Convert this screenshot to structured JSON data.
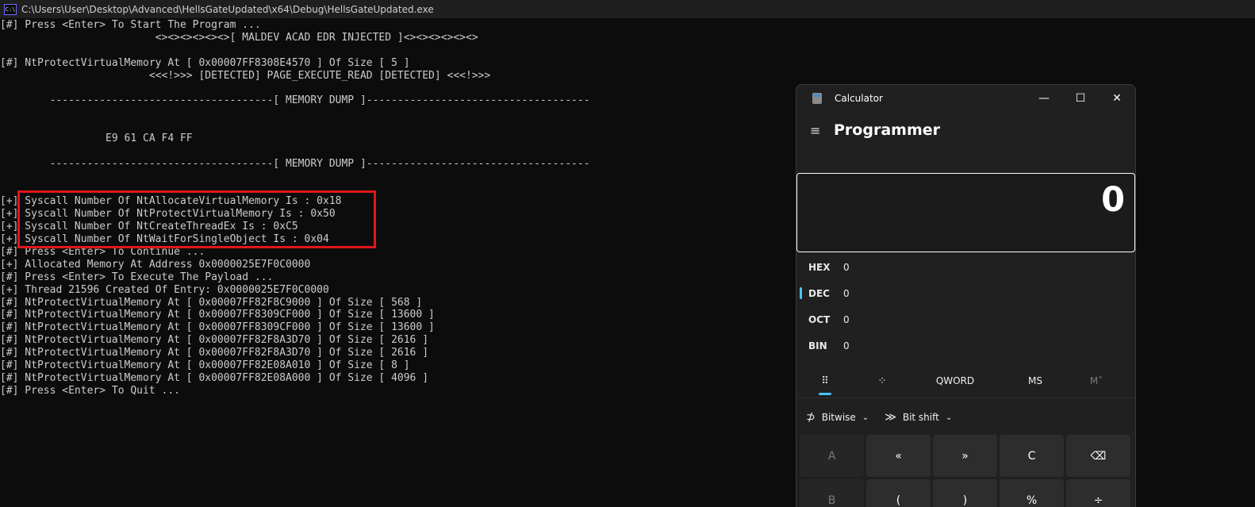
{
  "console": {
    "title": "C:\\Users\\User\\Desktop\\Advanced\\HellsGateUpdated\\x64\\Debug\\HellsGateUpdated.exe",
    "icon_label": "C:\\",
    "lines": [
      "[#] Press <Enter> To Start The Program ...",
      "                         <><><><><><>[ MALDEV ACAD EDR INJECTED ]<><><><><><>",
      "",
      "[#] NtProtectVirtualMemory At [ 0x00007FF8308E4570 ] Of Size [ 5 ]",
      "                        <<<!>>> [DETECTED] PAGE_EXECUTE_READ [DETECTED] <<<!>>>",
      "",
      "        ------------------------------------[ MEMORY DUMP ]------------------------------------",
      "",
      "",
      "                 E9 61 CA F4 FF",
      "",
      "        ------------------------------------[ MEMORY DUMP ]------------------------------------",
      "",
      "",
      "[+] Syscall Number Of NtAllocateVirtualMemory Is : 0x18",
      "[+] Syscall Number Of NtProtectVirtualMemory Is : 0x50",
      "[+] Syscall Number Of NtCreateThreadEx Is : 0xC5",
      "[+] Syscall Number Of NtWaitForSingleObject Is : 0x04",
      "[#] Press <Enter> To Continue ...",
      "[+] Allocated Memory At Address 0x0000025E7F0C0000",
      "[#] Press <Enter> To Execute The Payload ...",
      "[+] Thread 21596 Created Of Entry: 0x0000025E7F0C0000",
      "[#] NtProtectVirtualMemory At [ 0x00007FF82F8C9000 ] Of Size [ 568 ]",
      "[#] NtProtectVirtualMemory At [ 0x00007FF8309CF000 ] Of Size [ 13600 ]",
      "[#] NtProtectVirtualMemory At [ 0x00007FF8309CF000 ] Of Size [ 13600 ]",
      "[#] NtProtectVirtualMemory At [ 0x00007FF82F8A3D70 ] Of Size [ 2616 ]",
      "[#] NtProtectVirtualMemory At [ 0x00007FF82F8A3D70 ] Of Size [ 2616 ]",
      "[#] NtProtectVirtualMemory At [ 0x00007FF82E08A010 ] Of Size [ 8 ]",
      "[#] NtProtectVirtualMemory At [ 0x00007FF82E08A000 ] Of Size [ 4096 ]",
      "[#] Press <Enter> To Quit ..."
    ]
  },
  "calculator": {
    "title": "Calculator",
    "mode": "Programmer",
    "display_value": "0",
    "window_buttons": {
      "minimize": "—",
      "maximize": "☐",
      "close": "✕"
    },
    "menu_icon": "≡",
    "radix": [
      {
        "name": "HEX",
        "value": "0"
      },
      {
        "name": "DEC",
        "value": "0"
      },
      {
        "name": "OCT",
        "value": "0"
      },
      {
        "name": "BIN",
        "value": "0"
      }
    ],
    "toolbar": {
      "keypad_icon": "⠿",
      "bitpad_icon": "⁘",
      "word_size": "QWORD",
      "memory_store": "MS",
      "memory_view": "M˅"
    },
    "ops": {
      "bitwise_icon": "⊅",
      "bitwise": "Bitwise",
      "bitshift_icon": "≫",
      "bitshift": "Bit shift",
      "chevron": "⌄"
    },
    "keys": [
      {
        "label": "A",
        "disabled": true
      },
      {
        "label": "«",
        "disabled": false
      },
      {
        "label": "»",
        "disabled": false
      },
      {
        "label": "C",
        "disabled": false
      },
      {
        "label": "⌫",
        "disabled": false
      },
      {
        "label": "B",
        "disabled": true
      },
      {
        "label": "(",
        "disabled": false
      },
      {
        "label": ")",
        "disabled": false
      },
      {
        "label": "%",
        "disabled": false
      },
      {
        "label": "÷",
        "disabled": false
      }
    ],
    "colors": {
      "accent": "#4cc2ff",
      "background": "#202020",
      "key": "#2d2d2d"
    }
  },
  "highlight_color": "#e2161c"
}
